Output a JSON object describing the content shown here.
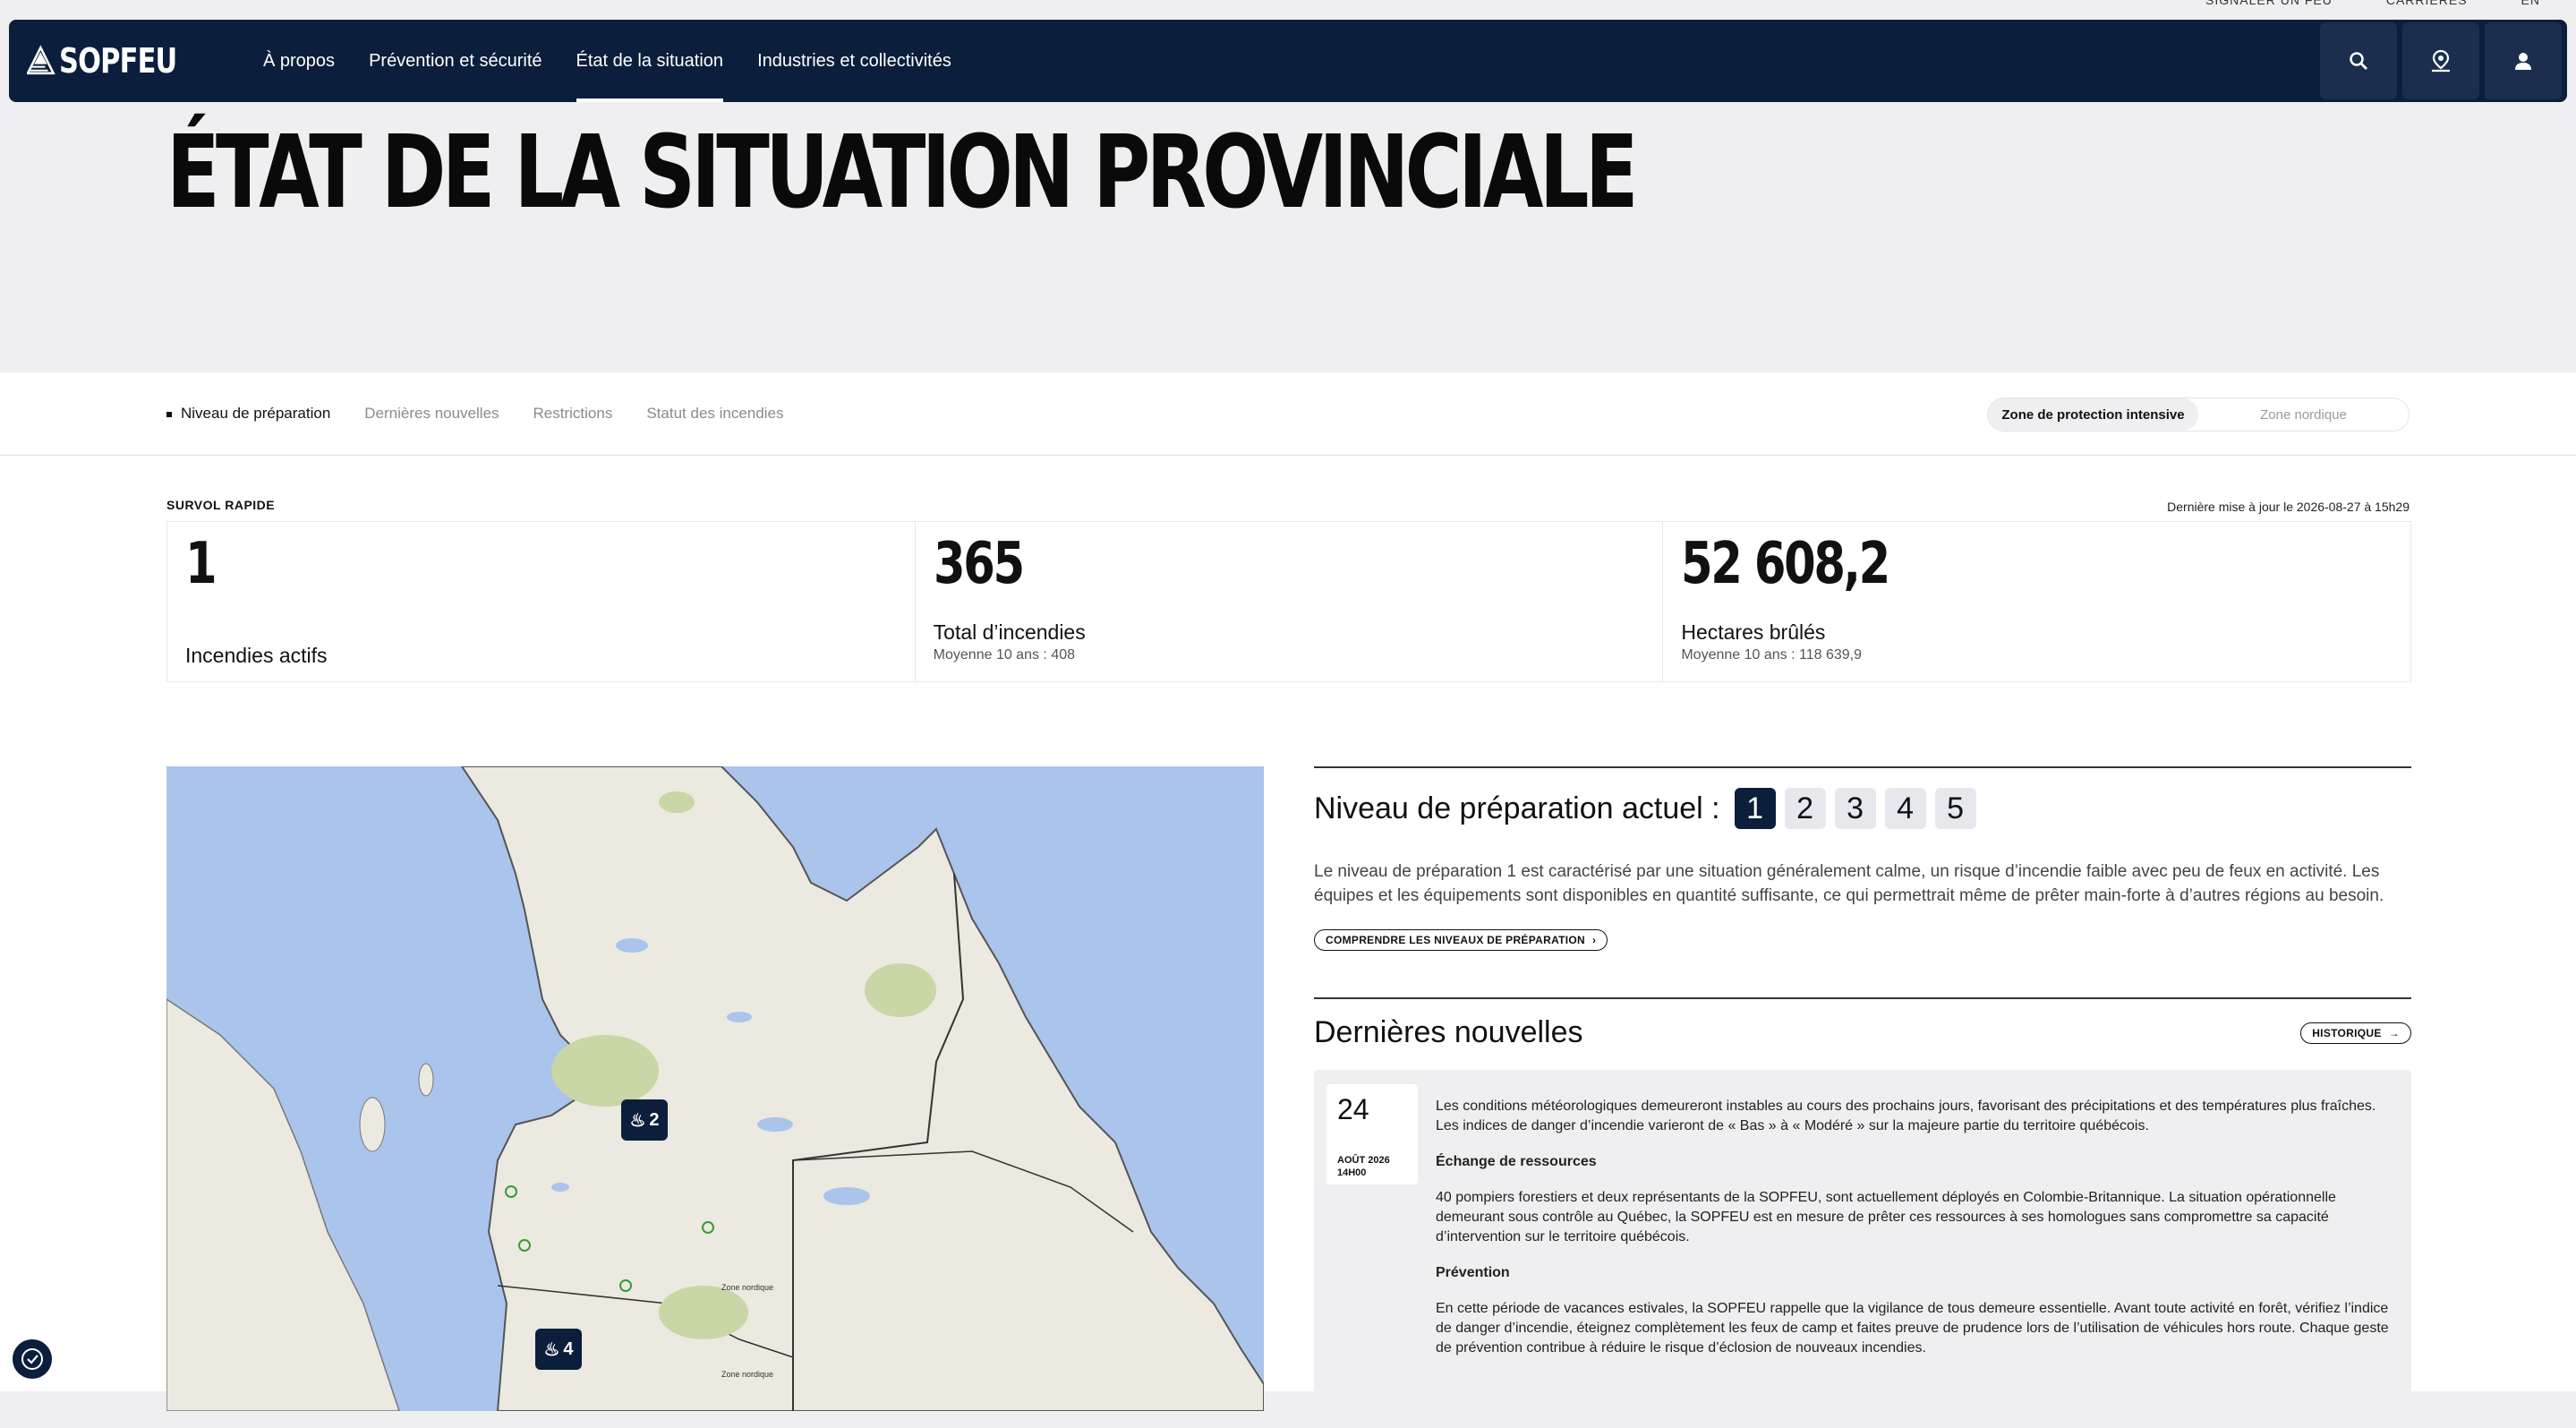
{
  "utility_links": [
    "SIGNALER UN FEU",
    "CARRIÈRES",
    "EN"
  ],
  "brand": {
    "name": "SOPFEU"
  },
  "nav": {
    "items": [
      "À propos",
      "Prévention et sécurité",
      "État de la situation",
      "Industries et collectivités"
    ],
    "active_index": 2,
    "icons": [
      "search-icon",
      "map-pin-icon",
      "user-icon"
    ]
  },
  "page": {
    "title": "ÉTAT DE LA SITUATION PROVINCIALE"
  },
  "subnav": {
    "links": [
      "Niveau de préparation",
      "Dernières nouvelles",
      "Restrictions",
      "Statut des incendies"
    ],
    "zones": [
      "Zone de protection intensive",
      "Zone nordique"
    ]
  },
  "survol": {
    "label": "SURVOL RAPIDE",
    "updated": "Dernière mise à jour le 2026-08-27 à 15h29",
    "stats": [
      {
        "value": "1",
        "label": "Incendies actifs",
        "sub": ""
      },
      {
        "value": "365",
        "label": "Total d’incendies",
        "sub": "Moyenne 10 ans : 408"
      },
      {
        "value": "52 608,2",
        "label": "Hectares brûlés",
        "sub": "Moyenne 10 ans : 118 639,9"
      }
    ]
  },
  "map": {
    "markers": [
      {
        "count": "2"
      },
      {
        "count": "4"
      }
    ],
    "labels": [
      "Zone nordique",
      "Zone nordique"
    ]
  },
  "preparation": {
    "title": "Niveau de préparation actuel :",
    "levels": [
      "1",
      "2",
      "3",
      "4",
      "5"
    ],
    "current": 1,
    "description": "Le niveau de préparation 1 est caractérisé par une situation généralement calme, un risque d’incendie faible avec peu de feux en activité. Les équipes et les équipements sont disponibles en quantité suffisante, ce qui permettrait même de prêter main-forte à d’autres régions au besoin.",
    "link": "COMPRENDRE LES NIVEAUX DE PRÉPARATION"
  },
  "news": {
    "title": "Dernières nouvelles",
    "history": "HISTORIQUE",
    "day": "24",
    "month": "AOÛT 2026",
    "time": "14H00",
    "p1": "Les conditions météorologiques demeureront instables au cours des prochains jours, favorisant des précipitations et des températures plus fraîches. Les indices de danger d’incendie varieront de « Bas » à « Modéré » sur la majeure partie du territoire québécois.",
    "h1": "Échange de ressources",
    "p2": "40 pompiers forestiers et deux représentants de la SOPFEU, sont actuellement déployés en Colombie-Britannique. La situation opérationnelle demeurant sous contrôle au Québec, la SOPFEU est en mesure de prêter ces ressources à ses homologues sans compromettre sa capacité d’intervention sur le territoire québécois.",
    "h2": "Prévention",
    "p3": "En cette période de vacances estivales, la SOPFEU rappelle que la vigilance de tous demeure essentielle. Avant toute activité en forêt, vérifiez l’indice de danger d’incendie, éteignez complètement les feux de camp et faites preuve de prudence lors de l’utilisation de véhicules hors route. Chaque geste de prévention contribue à réduire le risque d’éclosion de nouveaux incendies."
  },
  "colors": {
    "navy": "#0b1e3b",
    "page_bg": "#efeff1",
    "water": "#aac4ec",
    "land": "#ebe9e0",
    "park": "#c9d6a5"
  }
}
